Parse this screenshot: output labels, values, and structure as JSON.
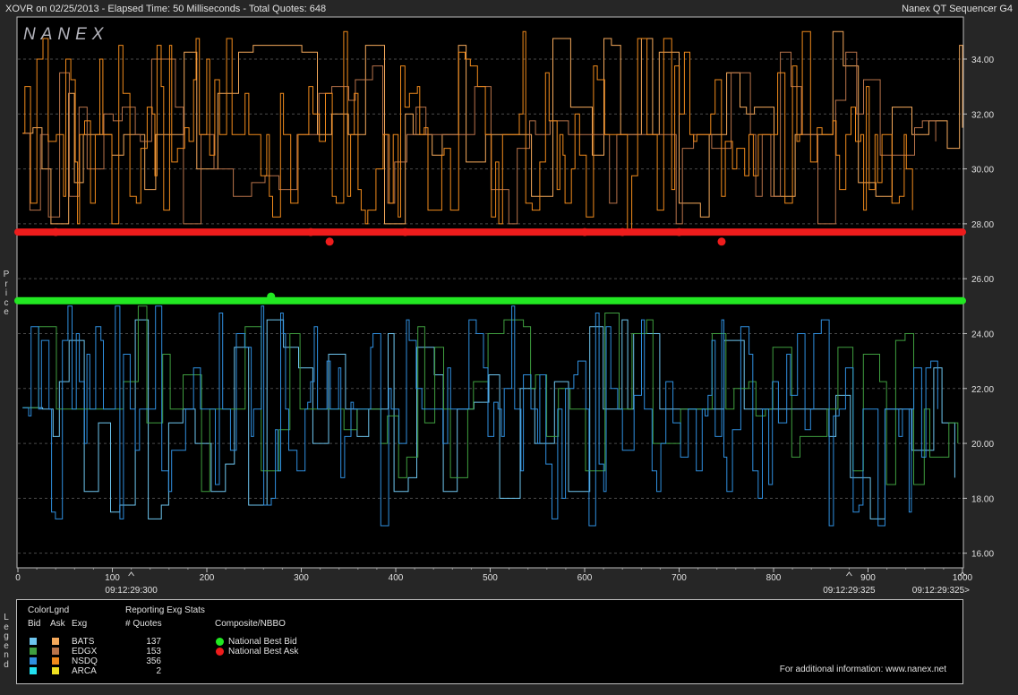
{
  "header": {
    "left": "XOVR on 02/25/2013  -  Elapsed Time: 50 Milliseconds  -  Total Quotes: 648",
    "right": "Nanex QT Sequencer G4"
  },
  "logo_text": "NANEX",
  "y_axis_label": "Price",
  "legend_label": "Legend",
  "legend": {
    "color_legend_title": "ColorLgnd",
    "col_bid": "Bid",
    "col_ask": "Ask",
    "col_exg": "Exg",
    "stats_title": "Reporting Exg Stats",
    "stats_col": "# Quotes",
    "composite_title": "Composite/NBBO",
    "exchanges": [
      {
        "name": "BATS",
        "quotes": "137",
        "bid_color": "#6ec6f0",
        "ask_color": "#f5a95b"
      },
      {
        "name": "EDGX",
        "quotes": "153",
        "bid_color": "#3f9e3f",
        "ask_color": "#b8734a"
      },
      {
        "name": "NSDQ",
        "quotes": "356",
        "bid_color": "#2f8fdf",
        "ask_color": "#f08a1c"
      },
      {
        "name": "ARCA",
        "quotes": "2",
        "bid_color": "#22e0f0",
        "ask_color": "#f0e020"
      }
    ],
    "nbbo": [
      {
        "name": "National Best Bid",
        "color": "#22e822"
      },
      {
        "name": "National Best Ask",
        "color": "#ee1c1c"
      }
    ],
    "footer": "For additional information: www.nanex.net"
  },
  "chart_data": {
    "type": "line",
    "x_axis": {
      "min": 0,
      "max": 1000,
      "ticks": [
        0,
        100,
        200,
        300,
        400,
        500,
        600,
        700,
        800,
        900,
        1000
      ],
      "time_labels": [
        {
          "x": 120,
          "label": "09:12:29:300"
        },
        {
          "x": 880,
          "label": "09:12:29:325"
        },
        {
          "x": 1000,
          "label": "09:12:29:325>"
        }
      ]
    },
    "y_axis": {
      "min": 15.5,
      "max": 35.5,
      "ticks": [
        16.0,
        18.0,
        20.0,
        22.0,
        24.0,
        26.0,
        28.0,
        30.0,
        32.0,
        34.0
      ],
      "label": "Price"
    },
    "grid": true,
    "series": [
      {
        "name": "National Best Ask",
        "color": "#ee1c1c",
        "role": "nbbo-ask",
        "values": [
          [
            0,
            27.7
          ],
          [
            1000,
            27.7
          ]
        ],
        "markers": [
          [
            40,
            27.7
          ],
          [
            310,
            27.7
          ],
          [
            330,
            27.35
          ],
          [
            410,
            27.7
          ],
          [
            600,
            27.7
          ],
          [
            640,
            27.7
          ],
          [
            700,
            27.7
          ],
          [
            745,
            27.35
          ]
        ]
      },
      {
        "name": "National Best Bid",
        "color": "#22e822",
        "role": "nbbo-bid",
        "values": [
          [
            0,
            25.2
          ],
          [
            1000,
            25.2
          ]
        ],
        "markers": [
          [
            268,
            25.35
          ]
        ]
      },
      {
        "name": "BATS Ask",
        "color": "#f5a95b",
        "role": "ask",
        "exchange": "BATS",
        "count": 137,
        "min": 27.8,
        "max": 35.0,
        "start": 31.3
      },
      {
        "name": "EDGX Ask",
        "color": "#b8734a",
        "role": "ask",
        "exchange": "EDGX",
        "count": 153,
        "min": 27.8,
        "max": 34.5,
        "start": 31.3
      },
      {
        "name": "NSDQ Ask",
        "color": "#f08a1c",
        "role": "ask",
        "exchange": "NSDQ",
        "count": 356,
        "min": 27.8,
        "max": 35.0,
        "start": 31.3
      },
      {
        "name": "BATS Bid",
        "color": "#6ec6f0",
        "role": "bid",
        "exchange": "BATS",
        "count": 137,
        "min": 17.2,
        "max": 25.0,
        "start": 21.3
      },
      {
        "name": "EDGX Bid",
        "color": "#3f9e3f",
        "role": "bid",
        "exchange": "EDGX",
        "count": 153,
        "min": 17.5,
        "max": 25.0,
        "start": 21.3
      },
      {
        "name": "NSDQ Bid",
        "color": "#2f8fdf",
        "role": "bid",
        "exchange": "NSDQ",
        "count": 356,
        "min": 17.0,
        "max": 25.0,
        "start": 21.3
      }
    ]
  }
}
